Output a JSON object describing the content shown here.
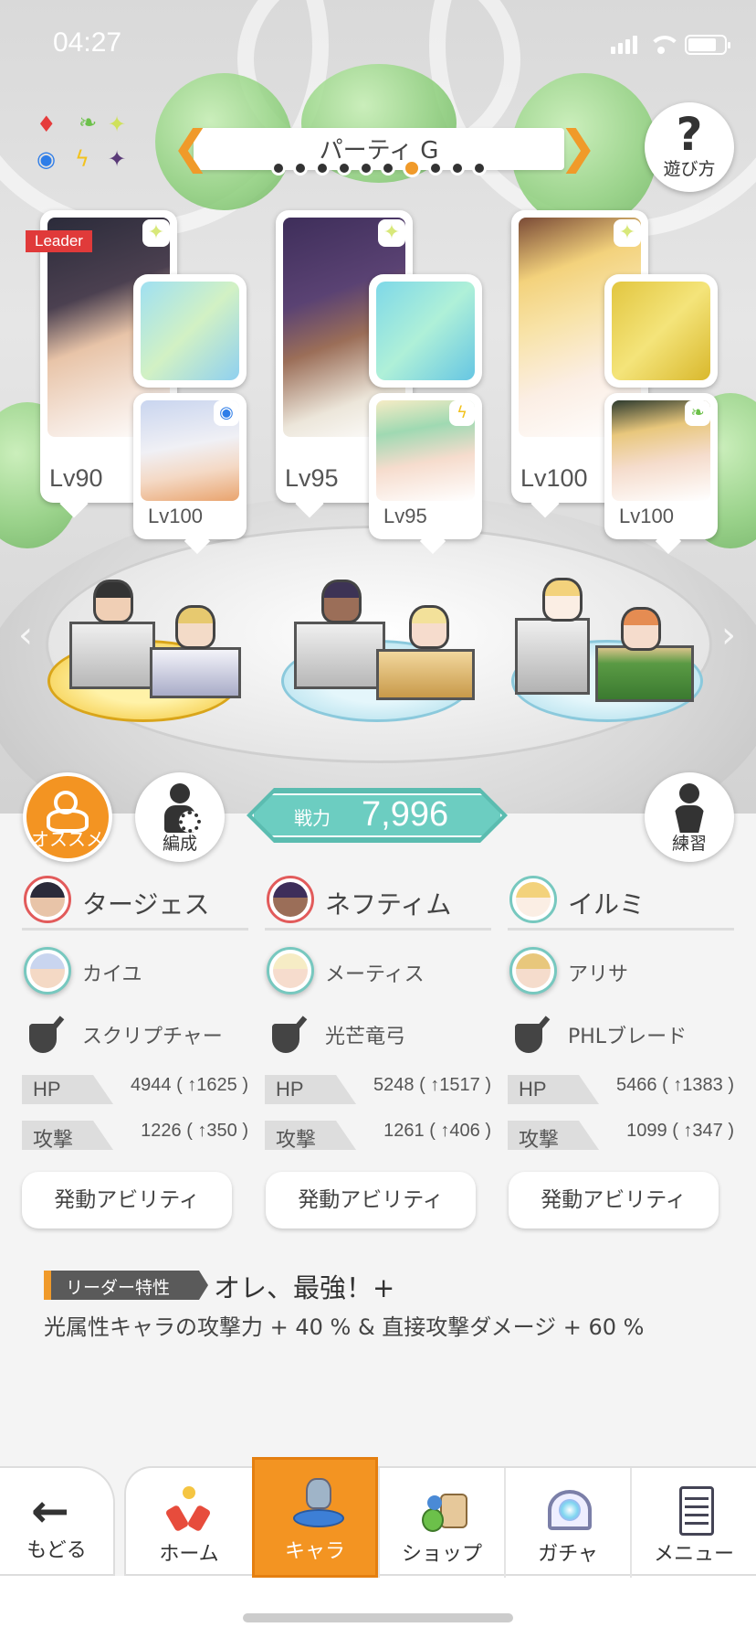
{
  "status_bar": {
    "time": "04:27"
  },
  "colors": {
    "accent": "#f39422",
    "teal": "#5bbcb0",
    "leader_red": "#e03a3a"
  },
  "party": {
    "title": "パーティ G",
    "page_count": 10,
    "active_page": 7,
    "help_label": "遊び方",
    "leader_tag": "Leader"
  },
  "members": [
    {
      "main_name": "タージェス",
      "main_level": "Lv90",
      "sub_name": "カイユ",
      "sub_level": "Lv100",
      "weapon_name": "スクリプチャー",
      "hp_label": "HP",
      "hp_value": "4944 ( ↑1625 )",
      "atk_label": "攻撃",
      "atk_value": "1226 ( ↑350 )",
      "ability_button": "発動アビリティ",
      "sub_element_icon": "water-circle-icon"
    },
    {
      "main_name": "ネフティム",
      "main_level": "Lv95",
      "sub_name": "メーティス",
      "sub_level": "Lv95",
      "weapon_name": "光芒竜弓",
      "hp_label": "HP",
      "hp_value": "5248 ( ↑1517 )",
      "atk_label": "攻撃",
      "atk_value": "1261 ( ↑406 )",
      "ability_button": "発動アビリティ",
      "sub_element_icon": "lightning-icon"
    },
    {
      "main_name": "イルミ",
      "main_level": "Lv100",
      "sub_name": "アリサ",
      "sub_level": "Lv100",
      "weapon_name": "PHLブレード",
      "hp_label": "HP",
      "hp_value": "5466 ( ↑1383 )",
      "atk_label": "攻撃",
      "atk_value": "1099 ( ↑347 )",
      "ability_button": "発動アビリティ",
      "sub_element_icon": "leaf-icon"
    }
  ],
  "actions": {
    "recommend_label": "オススメ",
    "formation_label": "編成",
    "practice_label": "練習",
    "power_label": "戦力",
    "power_value": "7,996"
  },
  "leader_skill": {
    "tag": "リーダー特性",
    "name": "オレ、最強！+",
    "description": "光属性キャラの攻撃力 + 40 % & 直接攻撃ダメージ + 60 %"
  },
  "nav": {
    "back_label": "もどる",
    "items": [
      {
        "label": "ホーム",
        "icon": "home-icon"
      },
      {
        "label": "キャラ",
        "icon": "character-icon"
      },
      {
        "label": "ショップ",
        "icon": "shop-icon"
      },
      {
        "label": "ガチャ",
        "icon": "gacha-icon"
      },
      {
        "label": "メニュー",
        "icon": "menu-icon"
      }
    ],
    "active_item": "キャラ"
  }
}
